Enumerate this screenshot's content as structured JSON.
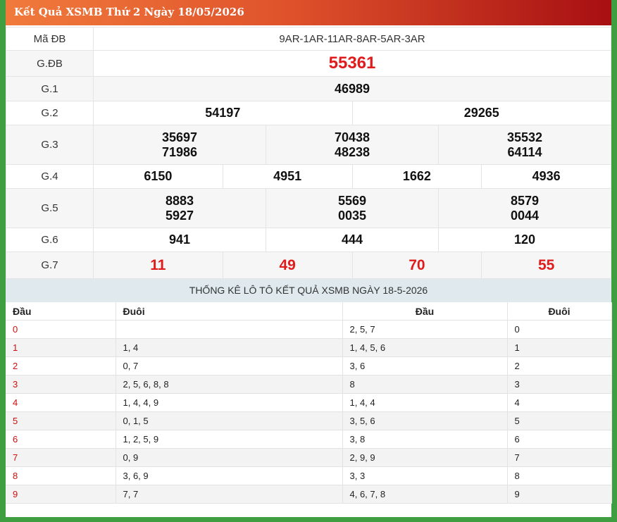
{
  "header": {
    "title": "Kết Quả XSMB Thứ 2 Ngày 18/05/2026"
  },
  "results": {
    "ma_db_label": "Mã ĐB",
    "ma_db": "9AR-1AR-11AR-8AR-5AR-3AR",
    "gdb_label": "G.ĐB",
    "gdb": "55361",
    "g1_label": "G.1",
    "g1": "46989",
    "g2_label": "G.2",
    "g2": [
      "54197",
      "29265"
    ],
    "g3_label": "G.3",
    "g3": [
      [
        "35697",
        "71986"
      ],
      [
        "70438",
        "48238"
      ],
      [
        "35532",
        "64114"
      ]
    ],
    "g4_label": "G.4",
    "g4": [
      "6150",
      "4951",
      "1662",
      "4936"
    ],
    "g5_label": "G.5",
    "g5": [
      [
        "8883",
        "5927"
      ],
      [
        "5569",
        "0035"
      ],
      [
        "8579",
        "0044"
      ]
    ],
    "g6_label": "G.6",
    "g6": [
      "941",
      "444",
      "120"
    ],
    "g7_label": "G.7",
    "g7": [
      "11",
      "49",
      "70",
      "55"
    ]
  },
  "stats": {
    "title": "THỐNG KÊ LÔ TÔ KẾT QUẢ XSMB NGÀY 18-5-2026",
    "headers": [
      "Đầu",
      "Đuôi",
      "Đầu",
      "Đuôi"
    ],
    "rows": [
      {
        "dau": "0",
        "duoi_list": "",
        "dau_list": "2, 5, 7",
        "duoi": "0"
      },
      {
        "dau": "1",
        "duoi_list": "1, 4",
        "dau_list": "1, 4, 5, 6",
        "duoi": "1"
      },
      {
        "dau": "2",
        "duoi_list": "0, 7",
        "dau_list": "3, 6",
        "duoi": "2"
      },
      {
        "dau": "3",
        "duoi_list": "2, 5, 6, 8, 8",
        "dau_list": "8",
        "duoi": "3"
      },
      {
        "dau": "4",
        "duoi_list": "1, 4, 4, 9",
        "dau_list": "1, 4, 4",
        "duoi": "4"
      },
      {
        "dau": "5",
        "duoi_list": "0, 1, 5",
        "dau_list": "3, 5, 6",
        "duoi": "5"
      },
      {
        "dau": "6",
        "duoi_list": "1, 2, 5, 9",
        "dau_list": "3, 8",
        "duoi": "6"
      },
      {
        "dau": "7",
        "duoi_list": "0, 9",
        "dau_list": "2, 9, 9",
        "duoi": "7"
      },
      {
        "dau": "8",
        "duoi_list": "3, 6, 9",
        "dau_list": "3, 3",
        "duoi": "8"
      },
      {
        "dau": "9",
        "duoi_list": "7, 7",
        "dau_list": "4, 6, 7, 8",
        "duoi": "9"
      }
    ]
  },
  "colors": {
    "header_start": "#f07a3c",
    "header_end": "#a70f12",
    "highlight": "#e01b1b",
    "frame": "#3f9e3f"
  }
}
